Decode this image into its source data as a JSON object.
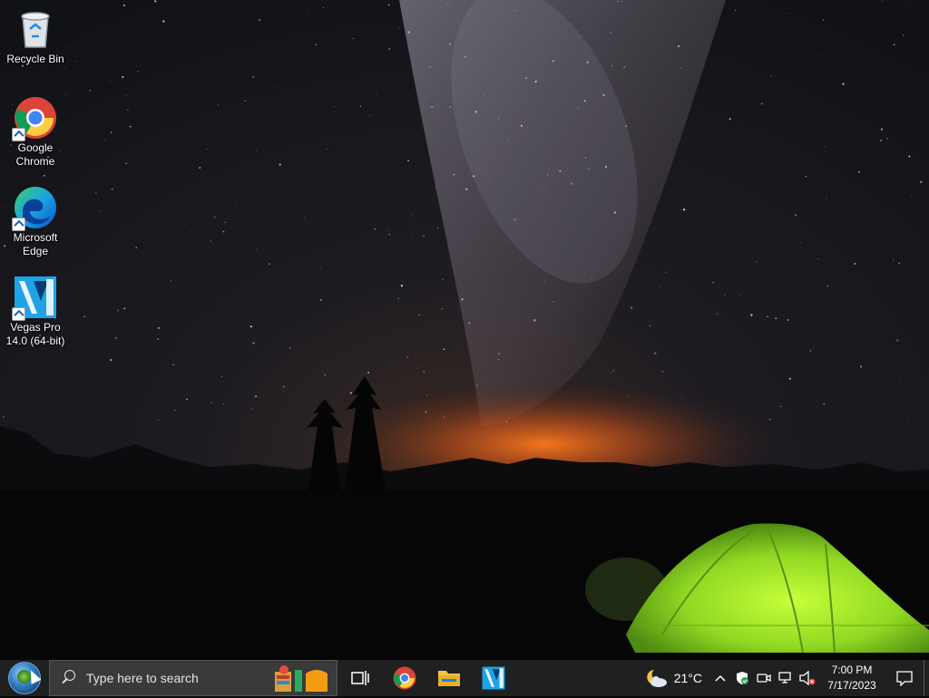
{
  "desktop": {
    "icons": [
      {
        "label": "Recycle Bin",
        "icon": "recycle-bin-icon"
      },
      {
        "label": "Google Chrome",
        "icon": "chrome-icon"
      },
      {
        "label": "Microsoft Edge",
        "icon": "edge-icon"
      },
      {
        "label": "Vegas Pro 14.0 (64-bit)",
        "icon": "vegas-pro-icon"
      }
    ]
  },
  "taskbar": {
    "search_placeholder": "Type here to search",
    "pinned": [
      {
        "name": "Task View",
        "icon": "task-view-icon"
      },
      {
        "name": "Google Chrome",
        "icon": "chrome-icon"
      },
      {
        "name": "File Explorer",
        "icon": "folder-icon"
      },
      {
        "name": "Vegas Pro",
        "icon": "vegas-pro-icon"
      }
    ],
    "weather": {
      "temperature": "21°C",
      "icon": "partly-cloudy-night-icon"
    },
    "tray_icons": [
      "chevron-up-icon",
      "security-shield-icon",
      "meet-now-icon",
      "network-icon",
      "volume-muted-icon"
    ],
    "clock": {
      "time": "7:00 PM",
      "date": "7/17/2023"
    }
  },
  "colors": {
    "taskbar_bg": "#1f2020",
    "search_bg": "#3a3a3a",
    "tent_green": "#9be82b",
    "horizon_glow": "#e2621a"
  }
}
